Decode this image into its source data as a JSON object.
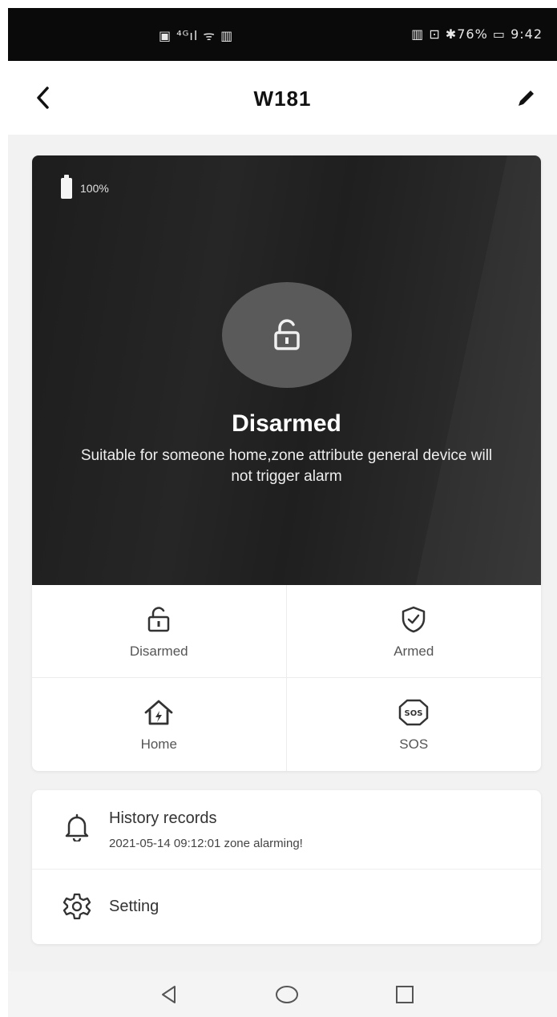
{
  "status_bar": {
    "left": "▣ ⁴ᴳıl ᯤ ▥",
    "right": "▥ ⊡ ✱76% ▭ 9:42"
  },
  "header": {
    "title": "W181",
    "back_icon": "chevron-left-icon",
    "edit_icon": "pencil-icon"
  },
  "device": {
    "battery": "100%",
    "state_title": "Disarmed",
    "state_description": "Suitable for someone home,zone attribute general device will not trigger alarm"
  },
  "modes": [
    {
      "label": "Disarmed",
      "icon": "unlock-icon"
    },
    {
      "label": "Armed",
      "icon": "shield-check-icon"
    },
    {
      "label": "Home",
      "icon": "home-icon"
    },
    {
      "label": "SOS",
      "icon": "sos-icon"
    }
  ],
  "list": {
    "history": {
      "label": "History records",
      "subtitle": "2021-05-14 09:12:01 zone alarming!",
      "icon": "bell-icon"
    },
    "setting": {
      "label": "Setting",
      "icon": "gear-icon"
    }
  },
  "nav": {
    "back_icon": "triangle-back-icon",
    "home_icon": "circle-home-icon",
    "recents_icon": "square-recents-icon"
  },
  "colors": {
    "hero_bg": "#222222",
    "circle": "#5a5a5a",
    "status_bar": "#0a0a0a"
  }
}
